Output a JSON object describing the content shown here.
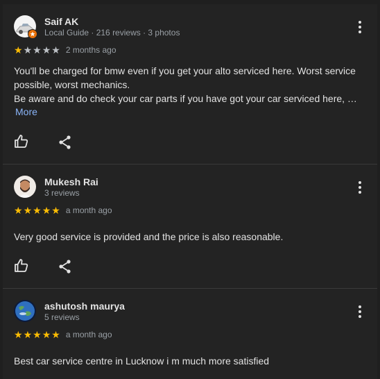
{
  "reviews": [
    {
      "name": "Saif AK",
      "meta": "Local Guide · 216 reviews · 3 photos",
      "rating": 1,
      "time": "2 months ago",
      "lines": [
        "You'll be charged for bmw even if you get your alto serviced here. Worst service",
        "possible, worst mechanics.",
        "Be aware and do check your car parts if you have got your car serviced here, …"
      ],
      "more_label": "More",
      "avatar_icon": "white-car-photo-avatar",
      "badge_icon": "local-guide-badge-icon"
    },
    {
      "name": "Mukesh Rai",
      "meta": "3 reviews",
      "rating": 5,
      "time": "a month ago",
      "lines": [
        "Very good service is provided and the price is also reasonable."
      ],
      "avatar_icon": "bearded-man-photo-avatar"
    },
    {
      "name": "ashutosh maurya",
      "meta": "5 reviews",
      "rating": 5,
      "time": "a month ago",
      "lines": [
        "Best car service centre in Lucknow i m much more satisfied"
      ],
      "avatar_icon": "earth-globe-photo-avatar"
    }
  ],
  "icons": {
    "like": "thumbs-up-icon",
    "share": "share-icon",
    "menu": "more-vert-icon",
    "star": "star-icon"
  },
  "colors": {
    "background": "#232323",
    "star_on": "#fbbc04",
    "star_off": "#bdc1c6",
    "link": "#8ab4f8",
    "badge": "#e8710a"
  }
}
